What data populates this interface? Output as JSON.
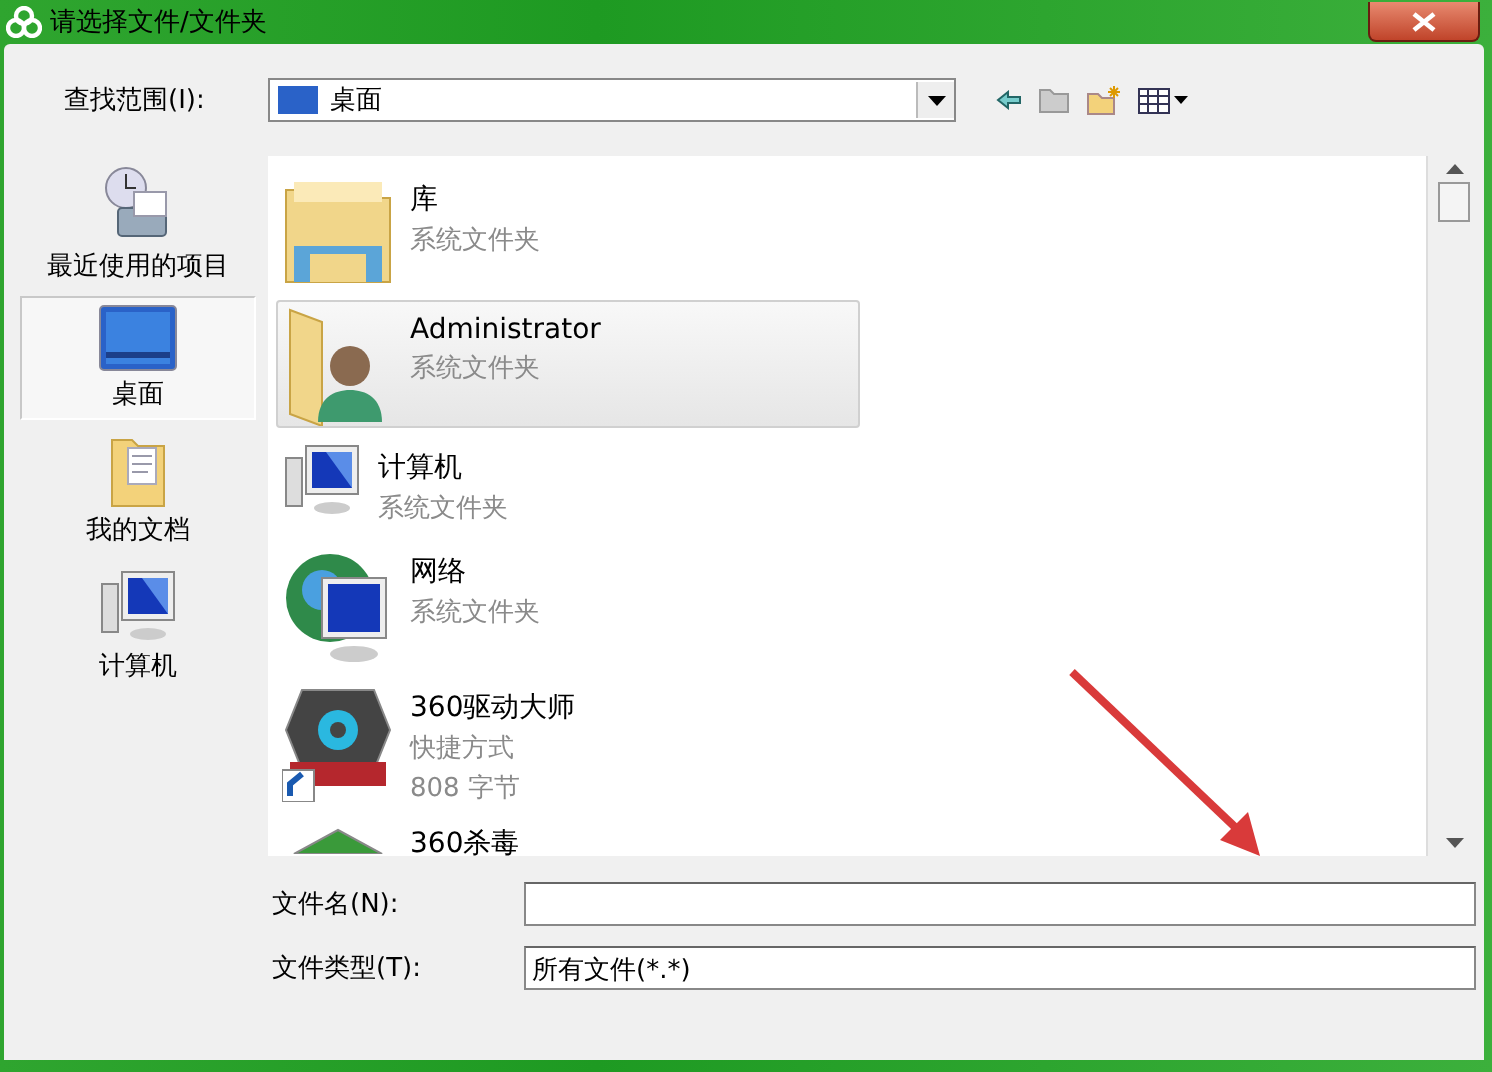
{
  "window": {
    "title": "请选择文件/文件夹"
  },
  "look_in": {
    "label": "查找范围(I):",
    "value": "桌面"
  },
  "places": [
    {
      "label": "最近使用的项目",
      "kind": "recent",
      "selected": false
    },
    {
      "label": "桌面",
      "kind": "desktop",
      "selected": true
    },
    {
      "label": "我的文档",
      "kind": "documents",
      "selected": false
    },
    {
      "label": "计算机",
      "kind": "computer",
      "selected": false
    }
  ],
  "files": [
    {
      "name": "库",
      "details": [
        "系统文件夹"
      ],
      "kind": "library",
      "selected": false
    },
    {
      "name": "Administrator",
      "details": [
        "系统文件夹"
      ],
      "kind": "user",
      "selected": true
    },
    {
      "name": "计算机",
      "details": [
        "系统文件夹"
      ],
      "kind": "computer",
      "selected": false
    },
    {
      "name": "网络",
      "details": [
        "系统文件夹"
      ],
      "kind": "network",
      "selected": false
    },
    {
      "name": "360驱动大师",
      "details": [
        "快捷方式",
        "808 字节"
      ],
      "kind": "shortcut",
      "selected": false
    },
    {
      "name": "360杀毒",
      "kind": "shield",
      "selected": false
    }
  ],
  "file_name": {
    "label": "文件名(N):"
  },
  "file_type": {
    "label": "文件类型(T):",
    "value": "所有文件(*.*)"
  }
}
